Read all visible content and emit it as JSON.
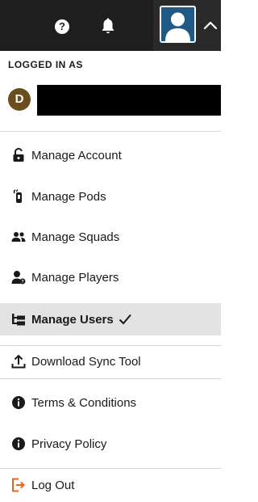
{
  "topbar": {
    "help_glyph": "?",
    "icons": [
      "help-icon",
      "bell-icon",
      "user-avatar-icon",
      "chevron-up-icon"
    ]
  },
  "account": {
    "logged_in_label": "LOGGED IN AS",
    "avatar_initial": "D",
    "username": "",
    "username_redacted": true
  },
  "menu": {
    "items": [
      {
        "label": "Manage Account",
        "icon": "lock-icon"
      },
      {
        "label": "Manage Pods",
        "icon": "pod-device-icon"
      },
      {
        "label": "Manage Squads",
        "icon": "group-icon"
      },
      {
        "label": "Manage Players",
        "icon": "player-icon"
      },
      {
        "label": "Manage Users",
        "icon": "hierarchy-icon",
        "active": true
      },
      {
        "label": "Download Sync Tool",
        "icon": "upload-icon"
      },
      {
        "label": "Terms & Conditions",
        "icon": "info-icon"
      },
      {
        "label": "Privacy Policy",
        "icon": "info-icon"
      },
      {
        "label": "Log Out",
        "icon": "logout-icon"
      }
    ]
  },
  "colors": {
    "topbar_bg": "#1e1e1e",
    "avatar_bg": "#1f5a87",
    "user_avatar_bg": "#6b4e1e",
    "active_row_bg": "#e3e3e3",
    "logout_icon": "#e8641b"
  }
}
